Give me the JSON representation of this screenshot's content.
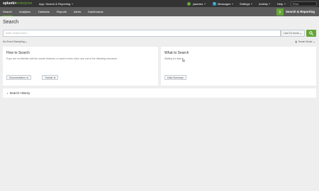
{
  "topbar": {
    "logo_main": "splunk>",
    "logo_suffix": "enterprise",
    "app_menu": "App: Search & Reporting",
    "user": "yaarnes",
    "messages": "Messages",
    "messages_count": "5",
    "settings": "Settings",
    "activity": "Activity",
    "help": "Help",
    "find_placeholder": "Find"
  },
  "appbar": {
    "nav": [
      "Search",
      "Analytics",
      "Datasets",
      "Reports",
      "Alerts",
      "Dashboards"
    ],
    "active_nav": "Search",
    "app_title": "Search & Reporting"
  },
  "search": {
    "title": "Search",
    "placeholder": "enter search here...",
    "time_range": "Last 24 hours",
    "sampling": "No Event Sampling",
    "mode": "Smart Mode"
  },
  "how_panel": {
    "title": "How to Search",
    "desc": "If you are not familiar with the search features, or want to learn more, see one of the following resources.",
    "doc_button": "Documentation",
    "tutorial_button": "Tutorial"
  },
  "what_panel": {
    "title": "What to Search",
    "desc": "Waiting for data...",
    "summary_button": "Data Summary"
  },
  "history": {
    "label": "Search History"
  },
  "colors": {
    "accent": "#65a637",
    "topbar": "#333333",
    "appbar": "#5c5c5c",
    "background": "#eeeeee"
  }
}
